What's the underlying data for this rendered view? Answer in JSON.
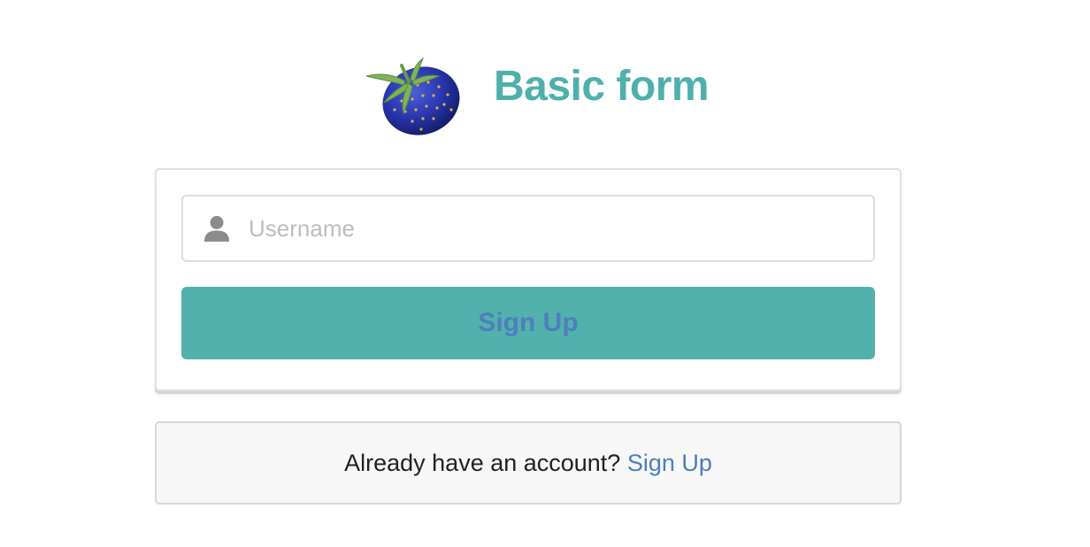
{
  "header": {
    "title": "Basic form",
    "logo_icon": "blue-strawberry-logo-icon"
  },
  "form": {
    "username": {
      "icon": "user-icon",
      "placeholder": "Username",
      "value": ""
    },
    "submit_label": "Sign Up"
  },
  "footer": {
    "text": "Already have an account?",
    "link_label": "Sign Up"
  },
  "colors": {
    "accent": "#52b1ac",
    "title": "#4fb0ab",
    "link": "#4a7fbe",
    "button_text": "#4e7ebd",
    "footer_bg": "#f7f7f7"
  }
}
